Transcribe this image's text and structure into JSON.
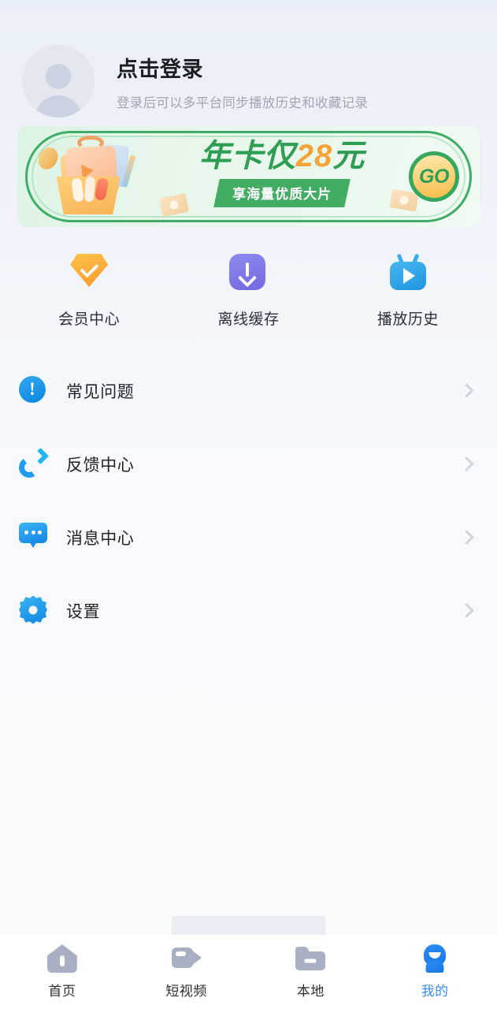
{
  "profile": {
    "title": "点击登录",
    "subtitle": "登录后可以多平台同步播放历史和收藏记录",
    "avatar_icon": "default-user-avatar-icon"
  },
  "banner": {
    "main_prefix": "年卡仅",
    "main_price": "28",
    "main_suffix": "元",
    "badge": "享海量优质大片",
    "cta": "GO",
    "colors": {
      "green": "#2f9e55",
      "orange": "#f6a33a",
      "badge_bg": "#43ac63"
    }
  },
  "quick_actions": [
    {
      "label": "会员中心",
      "icon": "diamond-icon",
      "color": "#f79a2c"
    },
    {
      "label": "离线缓存",
      "icon": "download-icon",
      "color": "#7268df"
    },
    {
      "label": "播放历史",
      "icon": "tv-play-icon",
      "color": "#1f95e0"
    }
  ],
  "menu": [
    {
      "label": "常见问题",
      "icon": "info-circle-icon",
      "chevron": "chevron-right-icon"
    },
    {
      "label": "反馈中心",
      "icon": "phone-outgoing-icon",
      "chevron": "chevron-right-icon"
    },
    {
      "label": "消息中心",
      "icon": "chat-bubble-icon",
      "chevron": "chevron-right-icon"
    },
    {
      "label": "设置",
      "icon": "gear-icon",
      "chevron": "chevron-right-icon"
    }
  ],
  "tabbar": {
    "active_color": "#3a8df0",
    "inactive_color": "#a9b0c4",
    "items": [
      {
        "label": "首页",
        "icon": "home-icon",
        "active": false
      },
      {
        "label": "短视频",
        "icon": "video-camera-icon",
        "active": false
      },
      {
        "label": "本地",
        "icon": "folder-icon",
        "active": false
      },
      {
        "label": "我的",
        "icon": "person-icon",
        "active": true
      }
    ]
  }
}
